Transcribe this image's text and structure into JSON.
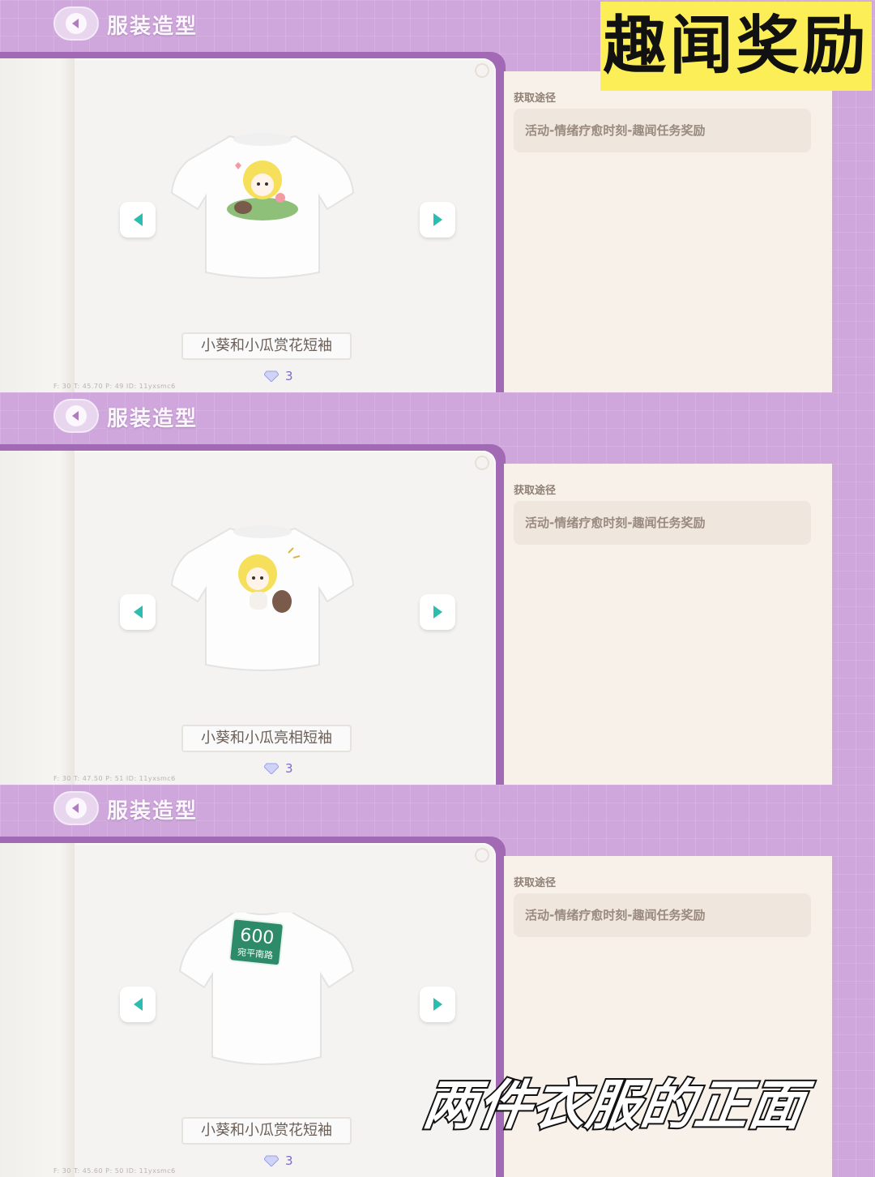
{
  "overlay": {
    "stamp_text": "趣闻奖励",
    "caption_text": "两件衣服的正面"
  },
  "panels": [
    {
      "header": {
        "title": "服装造型"
      },
      "item": {
        "name": "小葵和小瓜赏花短袖",
        "count": "3",
        "design": "sunflower-girl-on-leaf"
      },
      "source": {
        "heading": "获取途径",
        "text": "活动-情绪疗愈时刻-趣闻任务奖励"
      },
      "debug": "F: 30    T: 45.70    P: 49    ID: 11yxsmc6"
    },
    {
      "header": {
        "title": "服装造型"
      },
      "item": {
        "name": "小葵和小瓜亮相短袖",
        "count": "3",
        "design": "sunflower-girl-with-seed"
      },
      "source": {
        "heading": "获取途径",
        "text": "活动-情绪疗愈时刻-趣闻任务奖励"
      },
      "debug": "F: 30    T: 47.50    P: 51    ID: 11yxsmc6"
    },
    {
      "header": {
        "title": "服装造型"
      },
      "item": {
        "name": "小葵和小瓜赏花短袖",
        "count": "3",
        "design": "green-sign-600",
        "sign_number": "600",
        "sign_text": "宛平南路"
      },
      "source": {
        "heading": "获取途径",
        "text": "活动-情绪疗愈时刻-趣闻任务奖励"
      },
      "debug": "F: 30    T: 45.60    P: 50    ID: 11yxsmc6"
    }
  ],
  "colors": {
    "accent_teal": "#2bbdb0",
    "panel_purple": "#d0a7dd",
    "book_edge": "#a26ab5",
    "stamp_yellow": "#fcee57"
  },
  "icons": {
    "back": "back-arrow-icon",
    "prev": "prev-arrow-icon",
    "next": "next-arrow-icon",
    "currency": "gem-icon"
  }
}
